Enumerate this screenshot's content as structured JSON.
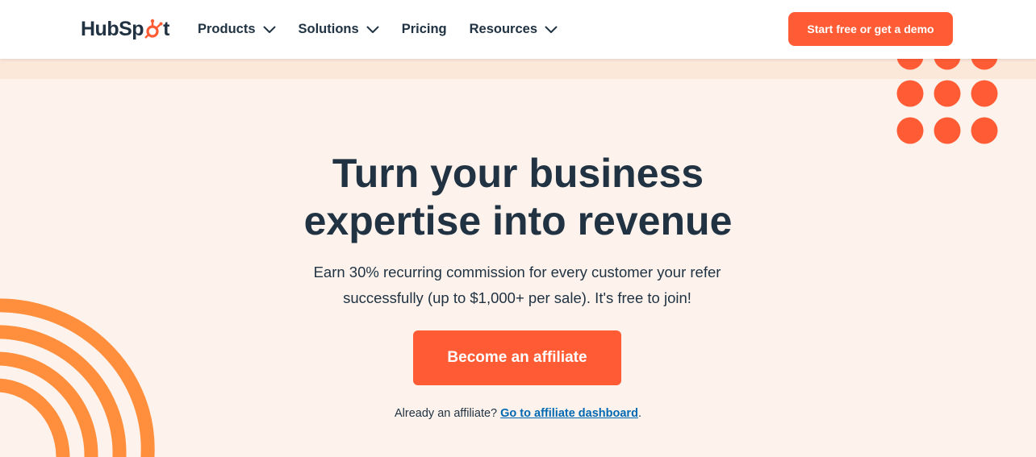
{
  "brand": {
    "name_part1": "Hub",
    "name_part2": "Sp",
    "name_part3": "t",
    "accent": "#ff5c35",
    "dark": "#213343",
    "link": "#0068b1",
    "hero_bg": "#fdf3ec",
    "band_bg": "#fce8d9",
    "arc_color": "#ff8f3c"
  },
  "nav": {
    "items": [
      {
        "label": "Products",
        "icon": "chevron-down-icon"
      },
      {
        "label": "Solutions",
        "icon": "chevron-down-icon"
      },
      {
        "label": "Pricing"
      },
      {
        "label": "Resources",
        "icon": "chevron-down-icon"
      }
    ],
    "cta_label": "Start free or get a demo"
  },
  "hero": {
    "title_line1": "Turn your business",
    "title_line2": "expertise into revenue",
    "subtitle_line1": "Earn 30% recurring commission for every customer your refer",
    "subtitle_line2": "successfully (up to $1,000+ per sale). It's free to join!",
    "cta_label": "Become an affiliate",
    "already_text": "Already an affiliate? ",
    "dashboard_link": "Go to affiliate dashboard",
    "already_suffix": "."
  }
}
